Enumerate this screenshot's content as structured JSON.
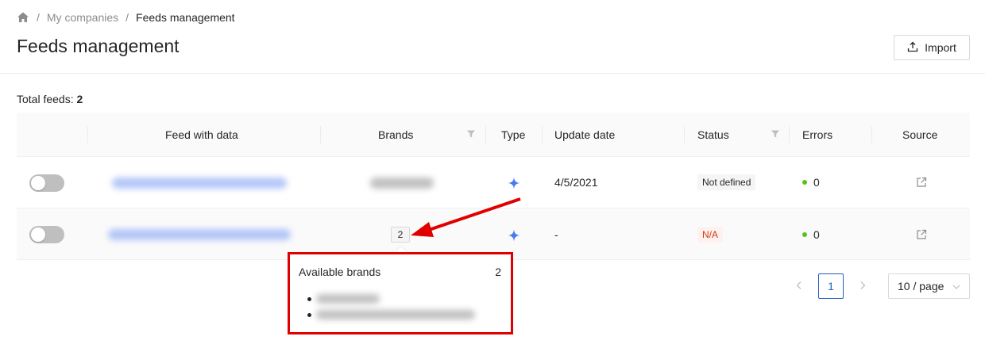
{
  "breadcrumb": {
    "home_icon": "home-icon",
    "separator": "/",
    "items": [
      "My companies",
      "Feeds management"
    ]
  },
  "header": {
    "title": "Feeds management",
    "import_label": "Import",
    "import_icon": "upload-icon"
  },
  "summary": {
    "total_label": "Total feeds:",
    "total_value": "2"
  },
  "table": {
    "columns": [
      "Feed with data",
      "Brands",
      "Type",
      "Update date",
      "Status",
      "Errors",
      "Source"
    ],
    "rows": [
      {
        "enabled": false,
        "feed": "",
        "brands": "",
        "type_icon": "sparkle-icon",
        "update_date": "4/5/2021",
        "status": "Not defined",
        "errors": "0",
        "source_icon": "external-link-icon"
      },
      {
        "enabled": false,
        "feed": "",
        "brands": "2",
        "type_icon": "sparkle-icon",
        "update_date": "-",
        "status": "N/A",
        "errors": "0",
        "source_icon": "external-link-icon"
      }
    ]
  },
  "popover": {
    "title": "Available brands",
    "count": "2"
  },
  "pagination": {
    "current_page": "1",
    "page_size": "10 / page"
  },
  "colors": {
    "accent": "#1f5fbf",
    "annotation_red": "#e00000",
    "status_ok": "#52c41a",
    "status_na": "#d4380d"
  }
}
